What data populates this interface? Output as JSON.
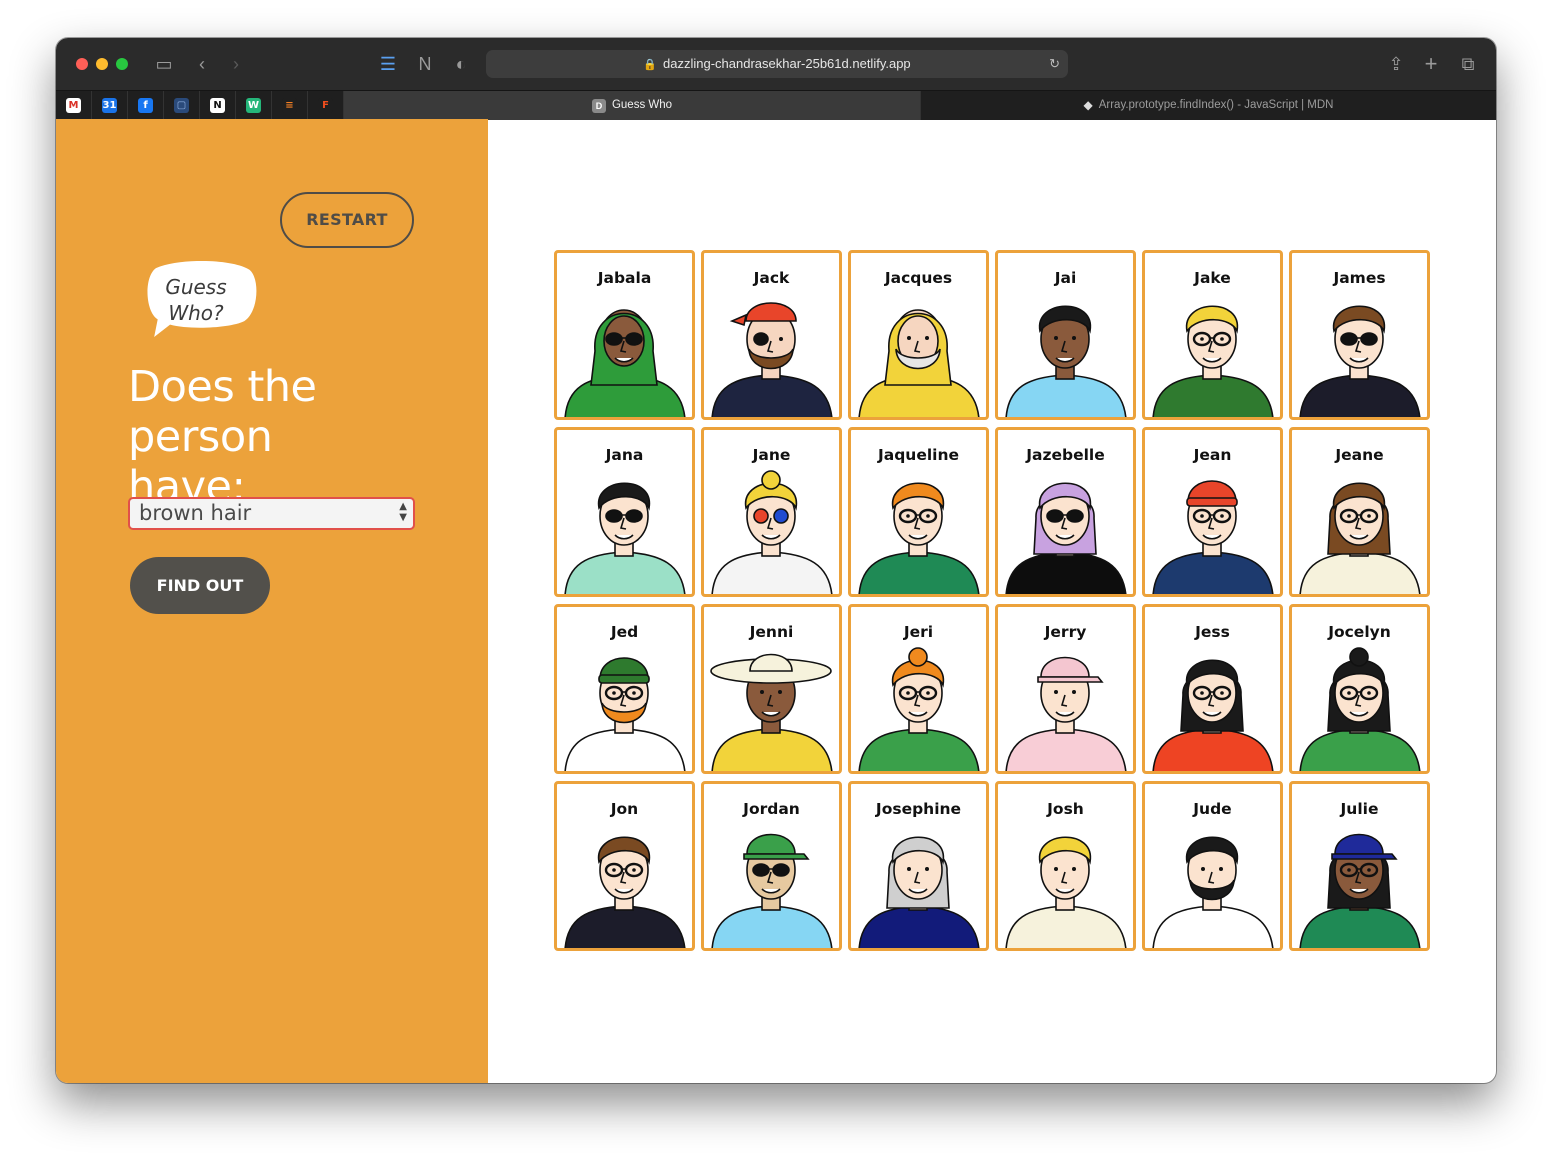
{
  "browser": {
    "url": "dazzling-chandrasekhar-25b61d.netlify.app",
    "tabs": [
      {
        "label": "Guess Who",
        "favicon": "D",
        "active": true
      },
      {
        "label": "Array.prototype.findIndex() - JavaScript | MDN",
        "active": false
      }
    ],
    "pinned_tabs": [
      {
        "icon": "gmail-icon",
        "glyph": "M",
        "color": "#ffffff",
        "fg": "#d93025"
      },
      {
        "icon": "calendar-icon",
        "glyph": "31",
        "color": "#1a73e8",
        "fg": "#ffffff"
      },
      {
        "icon": "facebook-icon",
        "glyph": "f",
        "color": "#1877f2",
        "fg": "#ffffff"
      },
      {
        "icon": "document-icon",
        "glyph": "▢",
        "color": "#2a4a7a",
        "fg": "#8fb0e0"
      },
      {
        "icon": "notion-icon",
        "glyph": "N",
        "color": "#ffffff",
        "fg": "#111111"
      },
      {
        "icon": "whimsical-icon",
        "glyph": "W",
        "color": "#25b67a",
        "fg": "#ffffff"
      },
      {
        "icon": "stackoverflow-icon",
        "glyph": "≡",
        "color": "#1f1f1f",
        "fg": "#f48024"
      },
      {
        "icon": "figma-icon",
        "glyph": "F",
        "color": "#1f1f1f",
        "fg": "#f24e1e"
      }
    ]
  },
  "sidebar": {
    "restart_label": "RESTART",
    "bubble_text_line1": "Guess",
    "bubble_text_line2": "Who?",
    "question_line1": "Does the person",
    "question_line2": "have:",
    "select_value": "brown hair",
    "find_out_label": "FIND OUT"
  },
  "colors": {
    "accent": "#eca23b",
    "button_dark": "#52504b",
    "select_border": "#e1504a"
  },
  "board": {
    "characters": [
      {
        "name": "Jabala",
        "hair": "#2e9c3a",
        "skin": "#8a5a3c",
        "shirt": "#2e9c3a",
        "hat": "hijab",
        "glasses": "dark"
      },
      {
        "name": "Jack",
        "hair": "#e8452a",
        "skin": "#f6d6c0",
        "shirt": "#1e2440",
        "hat": "bandana",
        "glasses": "patch"
      },
      {
        "name": "Jacques",
        "hair": "#f2d33a",
        "skin": "#f6d6c0",
        "shirt": "#f2d33a",
        "hat": "hood",
        "glasses": "none"
      },
      {
        "name": "Jai",
        "hair": "#1a1a1a",
        "skin": "#8a5a3c",
        "shirt": "#86d6f3",
        "hat": "none",
        "glasses": "none"
      },
      {
        "name": "Jake",
        "hair": "#f2d33a",
        "skin": "#fbe3cf",
        "shirt": "#2f7a2f",
        "hat": "none",
        "glasses": "clear"
      },
      {
        "name": "James",
        "hair": "#7a4a22",
        "skin": "#fbe3cf",
        "shirt": "#1c1c2a",
        "hat": "none",
        "glasses": "dark"
      },
      {
        "name": "Jana",
        "hair": "#1a1a1a",
        "skin": "#fbe3cf",
        "shirt": "#9be0c7",
        "hat": "none",
        "glasses": "dark"
      },
      {
        "name": "Jane",
        "hair": "#f2d33a",
        "skin": "#fbe3cf",
        "shirt": "#f4f4f4",
        "hat": "none",
        "glasses": "color"
      },
      {
        "name": "Jaqueline",
        "hair": "#f08a1e",
        "skin": "#fbe3cf",
        "shirt": "#1f8a55",
        "hat": "none",
        "glasses": "clear"
      },
      {
        "name": "Jazebelle",
        "hair": "#c8a2e0",
        "skin": "#fbe3cf",
        "shirt": "#0d0d0d",
        "hat": "none",
        "glasses": "dark"
      },
      {
        "name": "Jean",
        "hair": "#e8452a",
        "skin": "#fbe3cf",
        "shirt": "#1d3a6e",
        "hat": "beanie",
        "glasses": "clear"
      },
      {
        "name": "Jeane",
        "hair": "#7a4a22",
        "skin": "#fbe3cf",
        "shirt": "#f6f2dc",
        "hat": "none",
        "glasses": "clear"
      },
      {
        "name": "Jed",
        "hair": "#f08a1e",
        "skin": "#fbe3cf",
        "shirt": "#ffffff",
        "hat": "beanie-green",
        "glasses": "clear"
      },
      {
        "name": "Jenni",
        "hair": "#f6f2dc",
        "skin": "#8a5a3c",
        "shirt": "#f2d33a",
        "hat": "sunhat",
        "glasses": "none"
      },
      {
        "name": "Jeri",
        "hair": "#f08a1e",
        "skin": "#fbe3cf",
        "shirt": "#3aa04a",
        "hat": "none",
        "glasses": "clear"
      },
      {
        "name": "Jerry",
        "hair": "#f4c6d0",
        "skin": "#fbe3cf",
        "shirt": "#f8cdd6",
        "hat": "cap-pink",
        "glasses": "none"
      },
      {
        "name": "Jess",
        "hair": "#1a1a1a",
        "skin": "#fbe3cf",
        "shirt": "#ee4423",
        "hat": "none",
        "glasses": "clear"
      },
      {
        "name": "Jocelyn",
        "hair": "#1a1a1a",
        "skin": "#fbe3cf",
        "shirt": "#3aa04a",
        "hat": "none",
        "glasses": "clear"
      },
      {
        "name": "Jon",
        "hair": "#7a4a22",
        "skin": "#fbe3cf",
        "shirt": "#1c1c2a",
        "hat": "none",
        "glasses": "clear"
      },
      {
        "name": "Jordan",
        "hair": "#3aa04a",
        "skin": "#e6c9a0",
        "shirt": "#86d6f3",
        "hat": "cap-green",
        "glasses": "dark"
      },
      {
        "name": "Josephine",
        "hair": "#cfcfcf",
        "skin": "#fbe3cf",
        "shirt": "#121b7a",
        "hat": "none",
        "glasses": "none"
      },
      {
        "name": "Josh",
        "hair": "#f2d33a",
        "skin": "#fbe3cf",
        "shirt": "#f6f2dc",
        "hat": "none",
        "glasses": "none"
      },
      {
        "name": "Jude",
        "hair": "#1a1a1a",
        "skin": "#fbe3cf",
        "shirt": "#ffffff",
        "hat": "none",
        "glasses": "none"
      },
      {
        "name": "Julie",
        "hair": "#1a1a1a",
        "skin": "#8a5a3c",
        "shirt": "#1f8a55",
        "hat": "cap-blue",
        "glasses": "clear"
      }
    ]
  }
}
